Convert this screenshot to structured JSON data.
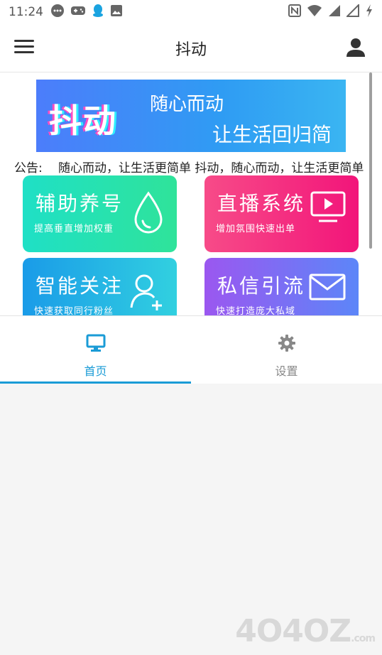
{
  "status_bar": {
    "time": "11:24",
    "left_icons": [
      "chat-icon",
      "gamepad-icon",
      "qq-icon",
      "image-icon"
    ],
    "right_icons": [
      "nfc-icon",
      "wifi-icon",
      "signal-icon",
      "signal-empty-icon",
      "battery-charging-icon"
    ]
  },
  "app_bar": {
    "title": "抖动",
    "menu_icon": "hamburger-menu-icon",
    "user_icon": "user-icon"
  },
  "banner": {
    "big_text": "抖动",
    "line1": "随心而动",
    "line2": "让生活回归简单"
  },
  "notice": {
    "label": "公告:",
    "text": "随心而动，让生活更简单  抖动，随心而动，让生活更简单"
  },
  "tiles": [
    {
      "title": "辅助养号",
      "subtitle": "提高垂直增加权重",
      "icon": "water-drop-icon"
    },
    {
      "title": "直播系统",
      "subtitle": "增加氛围快速出单",
      "icon": "play-screen-icon"
    },
    {
      "title": "智能关注",
      "subtitle": "快速获取同行粉丝",
      "icon": "add-user-icon"
    },
    {
      "title": "私信引流",
      "subtitle": "快速打造庞大私域",
      "icon": "mail-icon"
    }
  ],
  "tabs": [
    {
      "label": "首页",
      "icon": "monitor-icon",
      "active": true
    },
    {
      "label": "设置",
      "icon": "gear-icon",
      "active": false
    }
  ],
  "colors": {
    "accent": "#1a9bd6",
    "tile_a": "#1fe0c6",
    "tile_b": "#f2157a",
    "tile_c": "#1a9be8",
    "tile_d": "#9b57f0"
  },
  "watermark": {
    "text": "4O4OZ",
    "suffix": ".com"
  }
}
